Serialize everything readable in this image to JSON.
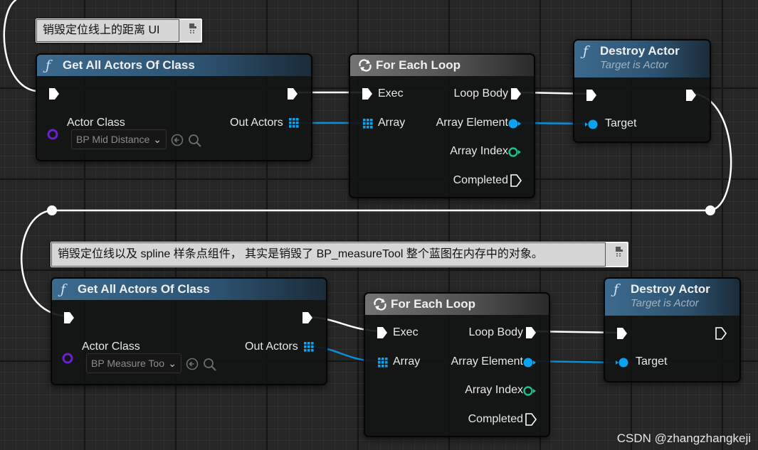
{
  "comments": {
    "c1": "销毁定位线上的距离 UI",
    "c2": "销毁定位线以及 spline 样条点组件， 其实是销毁了 BP_measureTool 整个蓝图在内存中的对象。"
  },
  "nodes": {
    "get1": {
      "title": "Get All Actors Of Class",
      "actor_class": "Actor Class",
      "out_actors": "Out Actors",
      "class_value": "BP Mid Distance"
    },
    "loop1": {
      "title": "For Each Loop",
      "exec": "Exec",
      "loop_body": "Loop Body",
      "array": "Array",
      "array_element": "Array Element",
      "array_index": "Array Index",
      "completed": "Completed"
    },
    "destroy1": {
      "title": "Destroy Actor",
      "subtitle": "Target is Actor",
      "target": "Target"
    },
    "get2": {
      "title": "Get All Actors Of Class",
      "actor_class": "Actor Class",
      "out_actors": "Out Actors",
      "class_value": "BP Measure Too"
    },
    "loop2": {
      "title": "For Each Loop",
      "exec": "Exec",
      "loop_body": "Loop Body",
      "array": "Array",
      "array_element": "Array Element",
      "array_index": "Array Index",
      "completed": "Completed"
    },
    "destroy2": {
      "title": "Destroy Actor",
      "subtitle": "Target is Actor",
      "target": "Target"
    }
  },
  "watermark": "CSDN @zhangzhangkeji",
  "colors": {
    "exec_wire": "#ffffff",
    "data_wire": "#0b8fd8",
    "object_pin": "#0aa3f0",
    "index_pin": "#1dc28a",
    "class_pin": "#6a1fd0",
    "function_header": "#3c6a8e",
    "macro_header": "#737373"
  },
  "icons": [
    "function-icon",
    "loop-icon",
    "exec-pin-icon",
    "array-grid-icon",
    "use-selected-asset-icon",
    "browse-search-icon",
    "chevron-down-icon",
    "comment-pin-icon"
  ]
}
